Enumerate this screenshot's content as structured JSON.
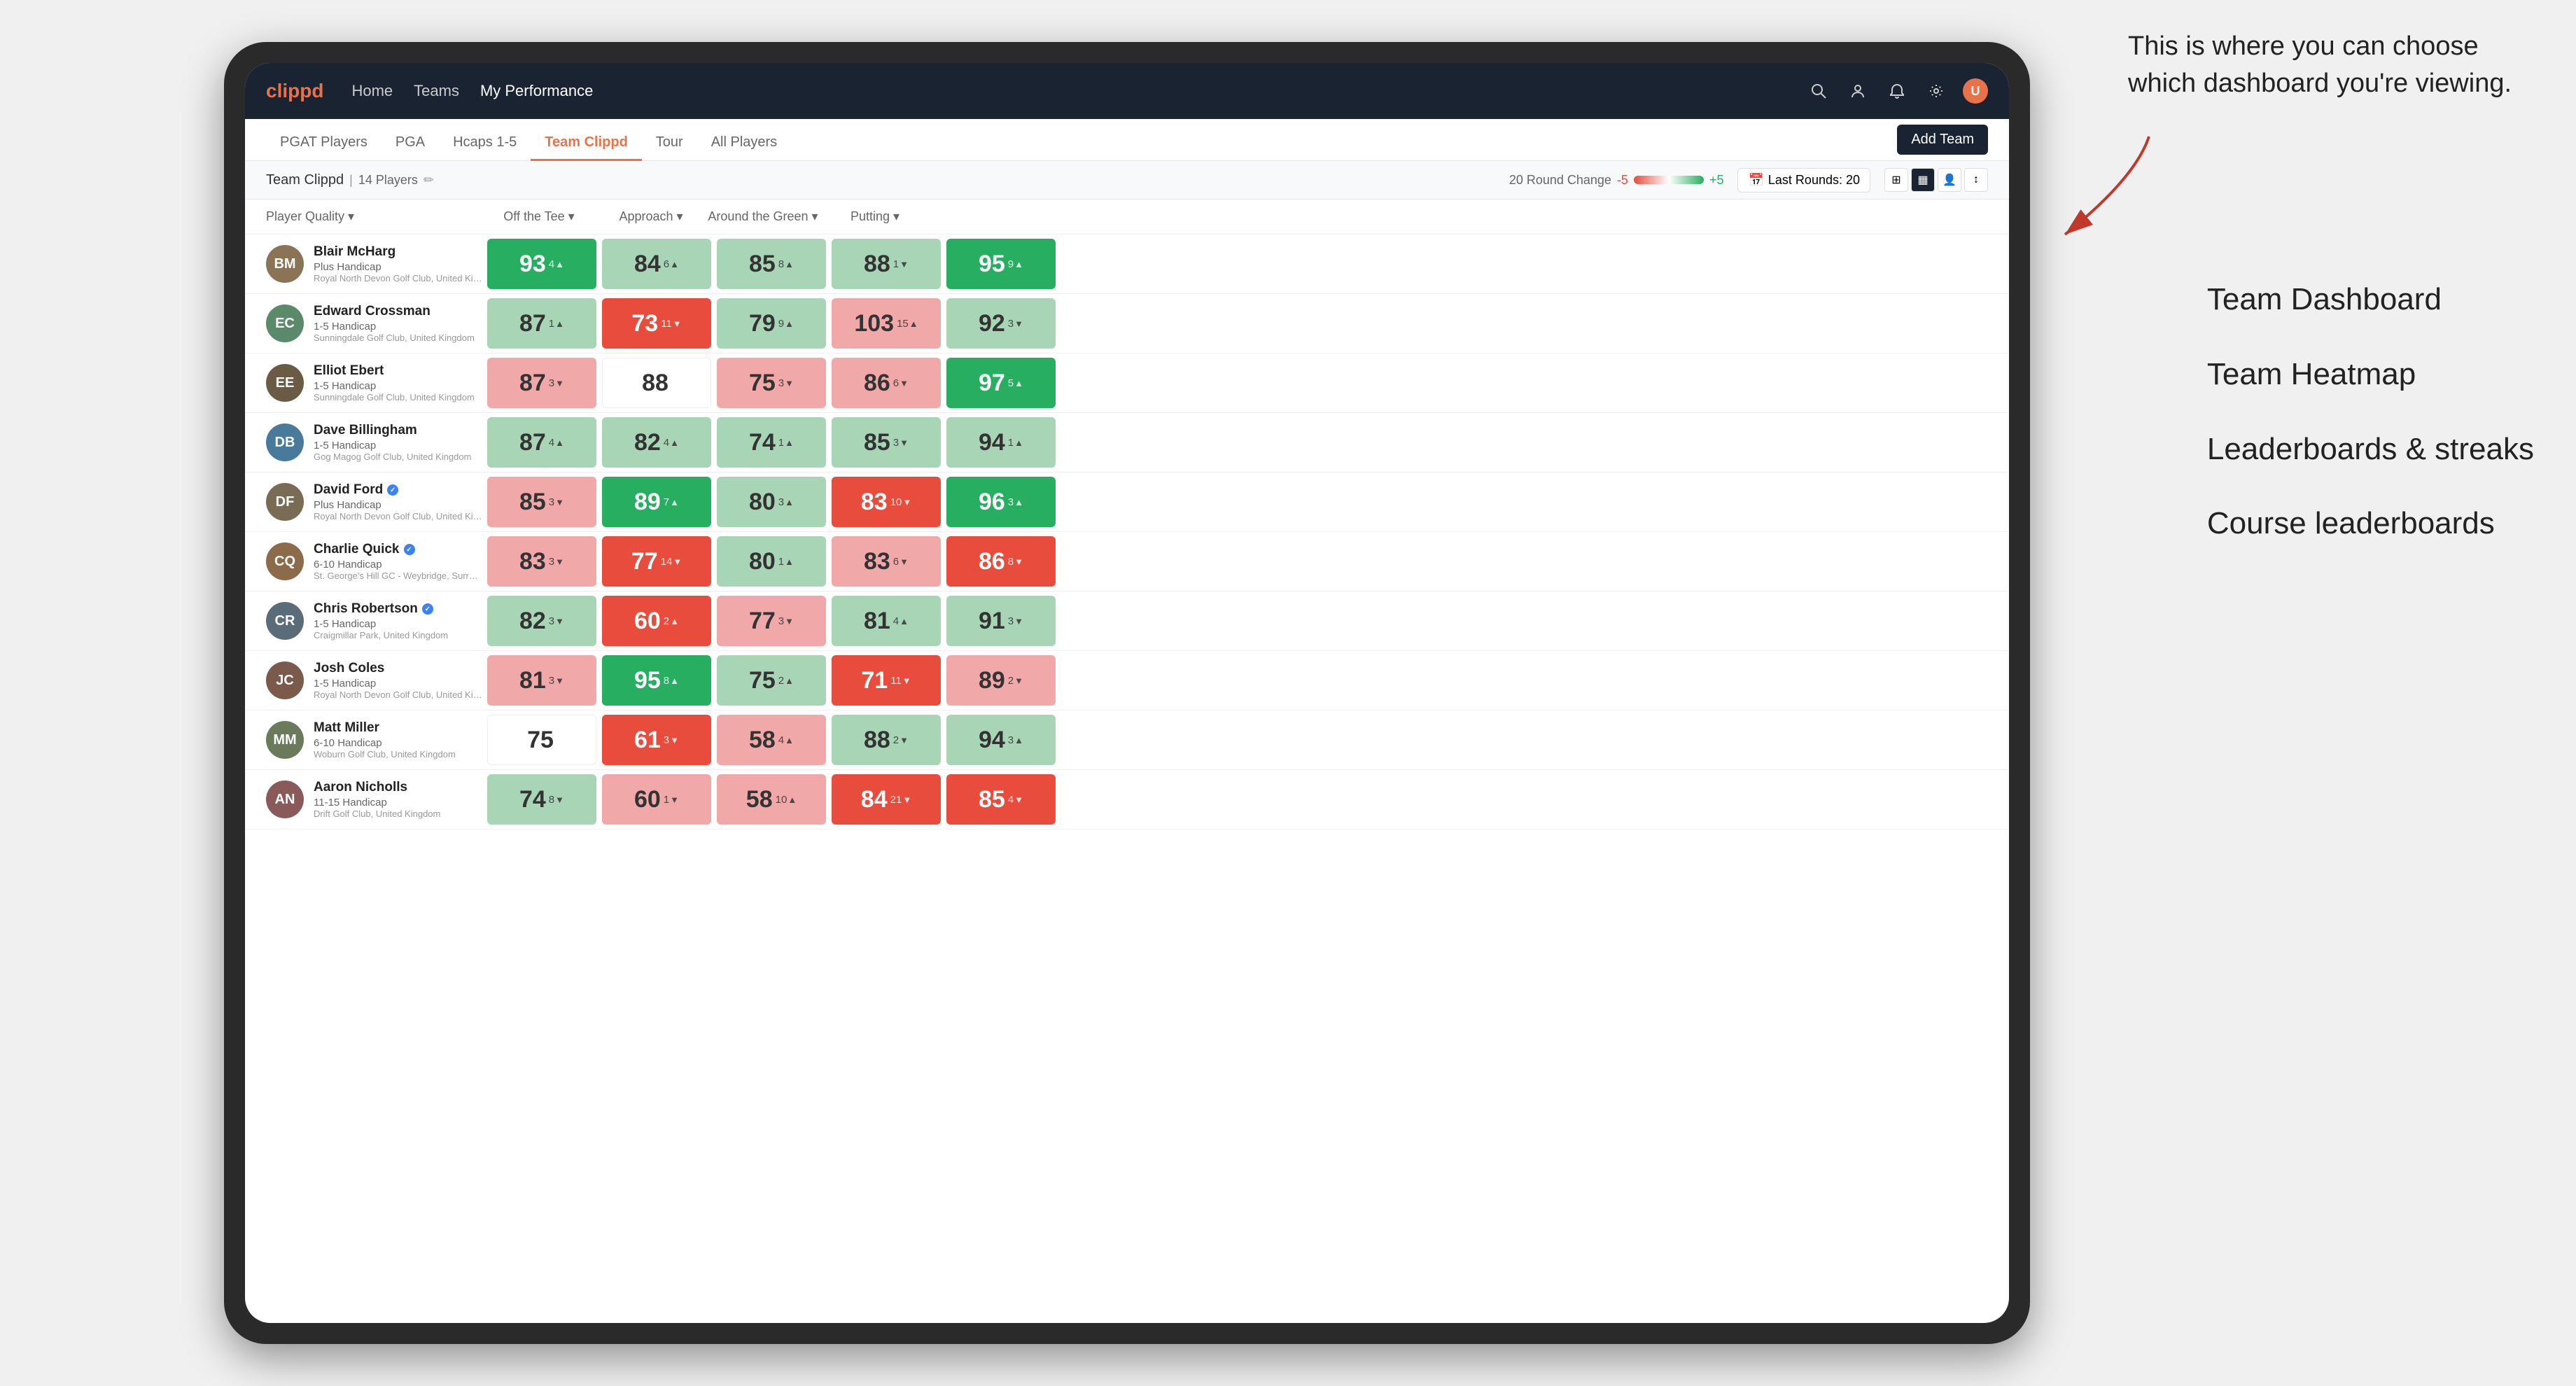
{
  "annotation": {
    "intro": "This is where you can choose which dashboard you're viewing.",
    "items": [
      "Team Dashboard",
      "Team Heatmap",
      "Leaderboards & streaks",
      "Course leaderboards"
    ]
  },
  "nav": {
    "logo": "clippd",
    "items": [
      "Home",
      "Teams",
      "My Performance"
    ],
    "active": "My Performance"
  },
  "sub_tabs": {
    "tabs": [
      "PGAT Players",
      "PGA",
      "Hcaps 1-5",
      "Team Clippd",
      "Tour",
      "All Players"
    ],
    "active": "Team Clippd",
    "add_team_label": "Add Team"
  },
  "team_bar": {
    "name": "Team Clippd",
    "player_count": "14 Players",
    "round_change_label": "20 Round Change",
    "range_min": "-5",
    "range_max": "+5",
    "last_rounds_label": "Last Rounds: 20"
  },
  "columns": {
    "player": "Player Quality ▾",
    "off_tee": "Off the Tee ▾",
    "approach": "Approach ▾",
    "around_green": "Around the Green ▾",
    "putting": "Putting ▾"
  },
  "players": [
    {
      "name": "Blair McHarg",
      "handicap": "Plus Handicap",
      "club": "Royal North Devon Golf Club, United Kingdom",
      "avatar_color": "#8B7355",
      "initials": "BM",
      "scores": {
        "quality": {
          "val": 93,
          "change": 4,
          "dir": "up",
          "bg": "bg-green-dark"
        },
        "off_tee": {
          "val": 84,
          "change": 6,
          "dir": "up",
          "bg": "bg-green-light"
        },
        "approach": {
          "val": 85,
          "change": 8,
          "dir": "up",
          "bg": "bg-green-light"
        },
        "around": {
          "val": 88,
          "change": 1,
          "dir": "down",
          "bg": "bg-green-light"
        },
        "putting": {
          "val": 95,
          "change": 9,
          "dir": "up",
          "bg": "bg-green-dark"
        }
      }
    },
    {
      "name": "Edward Crossman",
      "handicap": "1-5 Handicap",
      "club": "Sunningdale Golf Club, United Kingdom",
      "avatar_color": "#5a8a6a",
      "initials": "EC",
      "scores": {
        "quality": {
          "val": 87,
          "change": 1,
          "dir": "up",
          "bg": "bg-green-light"
        },
        "off_tee": {
          "val": 73,
          "change": 11,
          "dir": "down",
          "bg": "bg-red-dark"
        },
        "approach": {
          "val": 79,
          "change": 9,
          "dir": "up",
          "bg": "bg-green-light"
        },
        "around": {
          "val": 103,
          "change": 15,
          "dir": "up",
          "bg": "bg-red-light"
        },
        "putting": {
          "val": 92,
          "change": 3,
          "dir": "down",
          "bg": "bg-green-light"
        }
      }
    },
    {
      "name": "Elliot Ebert",
      "handicap": "1-5 Handicap",
      "club": "Sunningdale Golf Club, United Kingdom",
      "avatar_color": "#6b5b45",
      "initials": "EE",
      "scores": {
        "quality": {
          "val": 87,
          "change": 3,
          "dir": "down",
          "bg": "bg-red-light"
        },
        "off_tee": {
          "val": 88,
          "change": 0,
          "dir": "none",
          "bg": "bg-white"
        },
        "approach": {
          "val": 75,
          "change": 3,
          "dir": "down",
          "bg": "bg-red-light"
        },
        "around": {
          "val": 86,
          "change": 6,
          "dir": "down",
          "bg": "bg-red-light"
        },
        "putting": {
          "val": 97,
          "change": 5,
          "dir": "up",
          "bg": "bg-green-dark"
        }
      }
    },
    {
      "name": "Dave Billingham",
      "handicap": "1-5 Handicap",
      "club": "Gog Magog Golf Club, United Kingdom",
      "avatar_color": "#4a7a9b",
      "initials": "DB",
      "scores": {
        "quality": {
          "val": 87,
          "change": 4,
          "dir": "up",
          "bg": "bg-green-light"
        },
        "off_tee": {
          "val": 82,
          "change": 4,
          "dir": "up",
          "bg": "bg-green-light"
        },
        "approach": {
          "val": 74,
          "change": 1,
          "dir": "up",
          "bg": "bg-green-light"
        },
        "around": {
          "val": 85,
          "change": 3,
          "dir": "down",
          "bg": "bg-green-light"
        },
        "putting": {
          "val": 94,
          "change": 1,
          "dir": "up",
          "bg": "bg-green-light"
        }
      }
    },
    {
      "name": "David Ford",
      "handicap": "Plus Handicap",
      "club": "Royal North Devon Golf Club, United Kingdom",
      "avatar_color": "#7a6b55",
      "initials": "DF",
      "verified": true,
      "scores": {
        "quality": {
          "val": 85,
          "change": 3,
          "dir": "down",
          "bg": "bg-red-light"
        },
        "off_tee": {
          "val": 89,
          "change": 7,
          "dir": "up",
          "bg": "bg-green-dark"
        },
        "approach": {
          "val": 80,
          "change": 3,
          "dir": "up",
          "bg": "bg-green-light"
        },
        "around": {
          "val": 83,
          "change": 10,
          "dir": "down",
          "bg": "bg-red-dark"
        },
        "putting": {
          "val": 96,
          "change": 3,
          "dir": "up",
          "bg": "bg-green-dark"
        }
      }
    },
    {
      "name": "Charlie Quick",
      "handicap": "6-10 Handicap",
      "club": "St. George's Hill GC - Weybridge, Surrey, Uni...",
      "avatar_color": "#8B6B4A",
      "initials": "CQ",
      "verified": true,
      "scores": {
        "quality": {
          "val": 83,
          "change": 3,
          "dir": "down",
          "bg": "bg-red-light"
        },
        "off_tee": {
          "val": 77,
          "change": 14,
          "dir": "down",
          "bg": "bg-red-dark"
        },
        "approach": {
          "val": 80,
          "change": 1,
          "dir": "up",
          "bg": "bg-green-light"
        },
        "around": {
          "val": 83,
          "change": 6,
          "dir": "down",
          "bg": "bg-red-light"
        },
        "putting": {
          "val": 86,
          "change": 8,
          "dir": "down",
          "bg": "bg-red-dark"
        }
      }
    },
    {
      "name": "Chris Robertson",
      "handicap": "1-5 Handicap",
      "club": "Craigmillar Park, United Kingdom",
      "avatar_color": "#5a6b7a",
      "initials": "CR",
      "verified": true,
      "scores": {
        "quality": {
          "val": 82,
          "change": 3,
          "dir": "down",
          "bg": "bg-green-light"
        },
        "off_tee": {
          "val": 60,
          "change": 2,
          "dir": "up",
          "bg": "bg-red-dark"
        },
        "approach": {
          "val": 77,
          "change": 3,
          "dir": "down",
          "bg": "bg-red-light"
        },
        "around": {
          "val": 81,
          "change": 4,
          "dir": "up",
          "bg": "bg-green-light"
        },
        "putting": {
          "val": 91,
          "change": 3,
          "dir": "down",
          "bg": "bg-green-light"
        }
      }
    },
    {
      "name": "Josh Coles",
      "handicap": "1-5 Handicap",
      "club": "Royal North Devon Golf Club, United Kingdom",
      "avatar_color": "#7a5a4a",
      "initials": "JC",
      "scores": {
        "quality": {
          "val": 81,
          "change": 3,
          "dir": "down",
          "bg": "bg-red-light"
        },
        "off_tee": {
          "val": 95,
          "change": 8,
          "dir": "up",
          "bg": "bg-green-dark"
        },
        "approach": {
          "val": 75,
          "change": 2,
          "dir": "up",
          "bg": "bg-green-light"
        },
        "around": {
          "val": 71,
          "change": 11,
          "dir": "down",
          "bg": "bg-red-dark"
        },
        "putting": {
          "val": 89,
          "change": 2,
          "dir": "down",
          "bg": "bg-red-light"
        }
      }
    },
    {
      "name": "Matt Miller",
      "handicap": "6-10 Handicap",
      "club": "Woburn Golf Club, United Kingdom",
      "avatar_color": "#6a7a5a",
      "initials": "MM",
      "scores": {
        "quality": {
          "val": 75,
          "change": 0,
          "dir": "none",
          "bg": "bg-white"
        },
        "off_tee": {
          "val": 61,
          "change": 3,
          "dir": "down",
          "bg": "bg-red-dark"
        },
        "approach": {
          "val": 58,
          "change": 4,
          "dir": "up",
          "bg": "bg-red-light"
        },
        "around": {
          "val": 88,
          "change": 2,
          "dir": "down",
          "bg": "bg-green-light"
        },
        "putting": {
          "val": 94,
          "change": 3,
          "dir": "up",
          "bg": "bg-green-light"
        }
      }
    },
    {
      "name": "Aaron Nicholls",
      "handicap": "11-15 Handicap",
      "club": "Drift Golf Club, United Kingdom",
      "avatar_color": "#8a5a5a",
      "initials": "AN",
      "scores": {
        "quality": {
          "val": 74,
          "change": 8,
          "dir": "down",
          "bg": "bg-green-light"
        },
        "off_tee": {
          "val": 60,
          "change": 1,
          "dir": "down",
          "bg": "bg-red-light"
        },
        "approach": {
          "val": 58,
          "change": 10,
          "dir": "up",
          "bg": "bg-red-light"
        },
        "around": {
          "val": 84,
          "change": 21,
          "dir": "down",
          "bg": "bg-red-dark"
        },
        "putting": {
          "val": 85,
          "change": 4,
          "dir": "down",
          "bg": "bg-red-dark"
        }
      }
    }
  ]
}
